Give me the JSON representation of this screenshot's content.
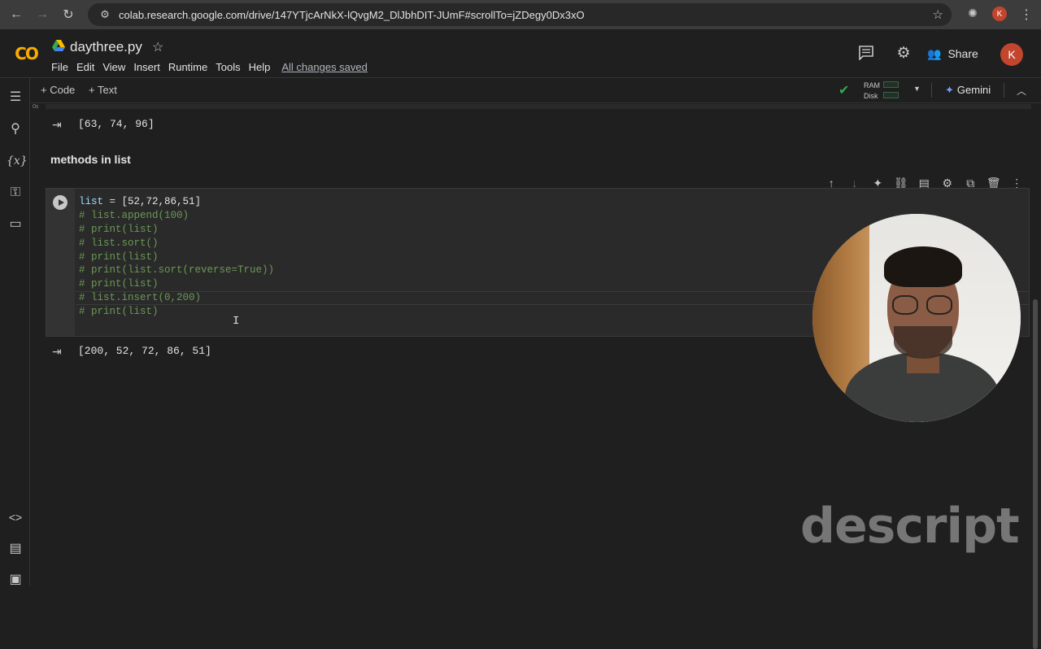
{
  "browser": {
    "back_icon": "arrow-back-icon",
    "forward_icon": "arrow-forward-icon",
    "reload_icon": "reload-icon",
    "url": "colab.research.google.com/drive/147YTjcArNkX-lQvgM2_DlJbhDIT-JUmF#scrollTo=jZDegy0Dx3xO",
    "profile_initial": "K"
  },
  "colab": {
    "logo_text": "CO",
    "title": "daythree.py",
    "menu": [
      "File",
      "Edit",
      "View",
      "Insert",
      "Runtime",
      "Tools",
      "Help"
    ],
    "save_status": "All changes saved",
    "share_label": "Share",
    "avatar_initial": "K"
  },
  "toolbar": {
    "add_code": "+ Code",
    "add_text": "+ Text",
    "ram_label": "RAM",
    "disk_label": "Disk",
    "gemini_label": "Gemini",
    "status_color": "#34a853"
  },
  "notebook": {
    "prev_output": "[63, 74, 96]",
    "exec_label": "0s",
    "heading": "methods in list",
    "code_lines": [
      {
        "t": "code",
        "text": "list = [52,72,86,51]"
      },
      {
        "t": "comment",
        "text": "# list.append(100)"
      },
      {
        "t": "comment",
        "text": "# print(list)"
      },
      {
        "t": "comment",
        "text": "# list.sort()"
      },
      {
        "t": "comment",
        "text": "# print(list)"
      },
      {
        "t": "comment",
        "text": "# print(list.sort(reverse=True))"
      },
      {
        "t": "comment",
        "text": "# print(list)"
      },
      {
        "t": "comment",
        "text": "# list.insert(0,200)"
      },
      {
        "t": "comment",
        "text": "# print(list)"
      }
    ],
    "cell_output": "[200, 52, 72, 86, 51]"
  },
  "overlay": {
    "watermark": "descript"
  }
}
